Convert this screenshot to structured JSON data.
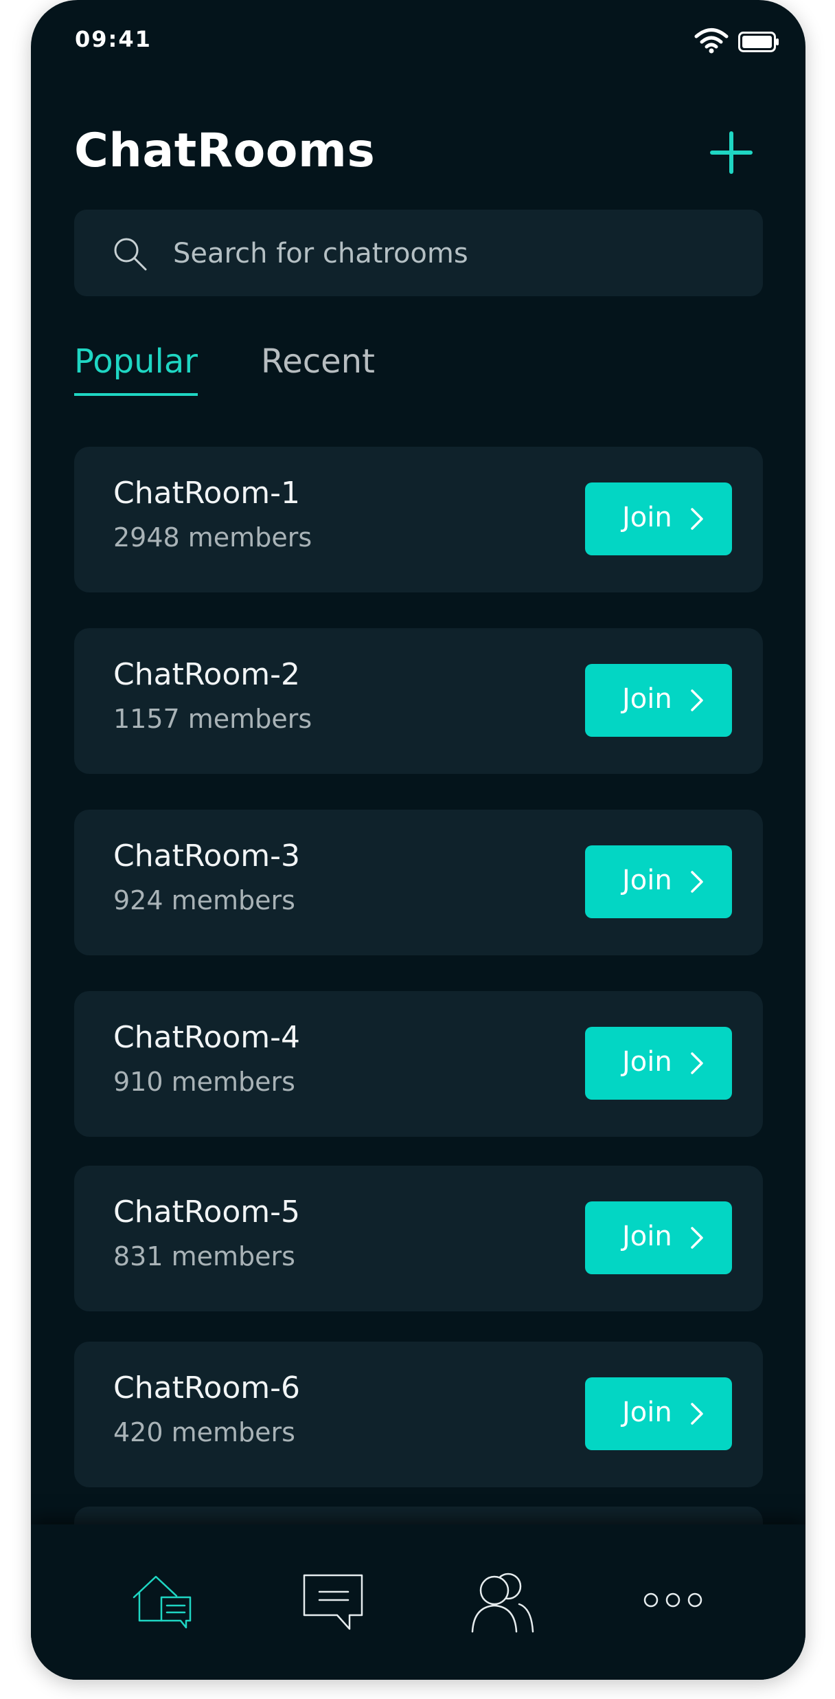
{
  "status_bar": {
    "time": "09:41"
  },
  "header": {
    "title": "ChatRooms",
    "add_icon": "plus-icon"
  },
  "search": {
    "placeholder": "Search for chatrooms",
    "value": ""
  },
  "tabs": [
    {
      "label": "Popular",
      "active": true
    },
    {
      "label": "Recent",
      "active": false
    }
  ],
  "rooms": [
    {
      "name": "ChatRoom-1",
      "members": "2948 members",
      "join_label": "Join"
    },
    {
      "name": "ChatRoom-2",
      "members": "1157 members",
      "join_label": "Join"
    },
    {
      "name": "ChatRoom-3",
      "members": "924 members",
      "join_label": "Join"
    },
    {
      "name": "ChatRoom-4",
      "members": "910 members",
      "join_label": "Join"
    },
    {
      "name": "ChatRoom-5",
      "members": "831 members",
      "join_label": "Join"
    },
    {
      "name": "ChatRoom-6",
      "members": "420 members",
      "join_label": "Join"
    }
  ],
  "bottom_nav": [
    {
      "icon": "home-chat-icon",
      "active": true
    },
    {
      "icon": "message-icon",
      "active": false
    },
    {
      "icon": "people-icon",
      "active": false
    },
    {
      "icon": "more-icon",
      "active": false
    }
  ],
  "colors": {
    "background": "#04141b",
    "card": "#0f222b",
    "accent": "#03d6c4",
    "text_primary": "#ffffff",
    "text_secondary": "#a9b3b7"
  }
}
